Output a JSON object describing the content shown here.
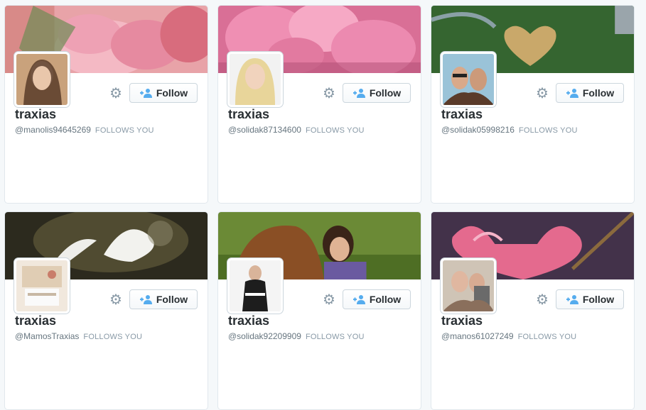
{
  "follow_label": "Follow",
  "cards": [
    {
      "name": "traxias",
      "handle": "@manolis94645269",
      "follows_you": "FOLLOWS YOU",
      "banner": "pink-roses",
      "avatar": "woman-portrait"
    },
    {
      "name": "traxias",
      "handle": "@solidak87134600",
      "follows_you": "FOLLOWS YOU",
      "banner": "pink-roses",
      "avatar": "blonde-woman"
    },
    {
      "name": "traxias",
      "handle": "@solidak05998216",
      "follows_you": "FOLLOWS YOU",
      "banner": "heart-island-aerial",
      "avatar": "two-women-sunglasses"
    },
    {
      "name": "traxias",
      "handle": "@MamosTraxias",
      "follows_you": "FOLLOWS YOU",
      "banner": "white-doves",
      "avatar": "shelf-room"
    },
    {
      "name": "traxias",
      "handle": "@solidak92209909",
      "follows_you": "FOLLOWS YOU",
      "banner": "girl-with-horse",
      "avatar": "woman-black-dress"
    },
    {
      "name": "traxias",
      "handle": "@manos61027249",
      "follows_you": "FOLLOWS YOU",
      "banner": "pink-paint-heart",
      "avatar": "two-women-photo"
    }
  ],
  "icons": {
    "settings": "gear-icon",
    "follow": "add-user-icon"
  },
  "colors": {
    "accent": "#55acee",
    "text": "#292f33",
    "muted": "#8899a6"
  }
}
